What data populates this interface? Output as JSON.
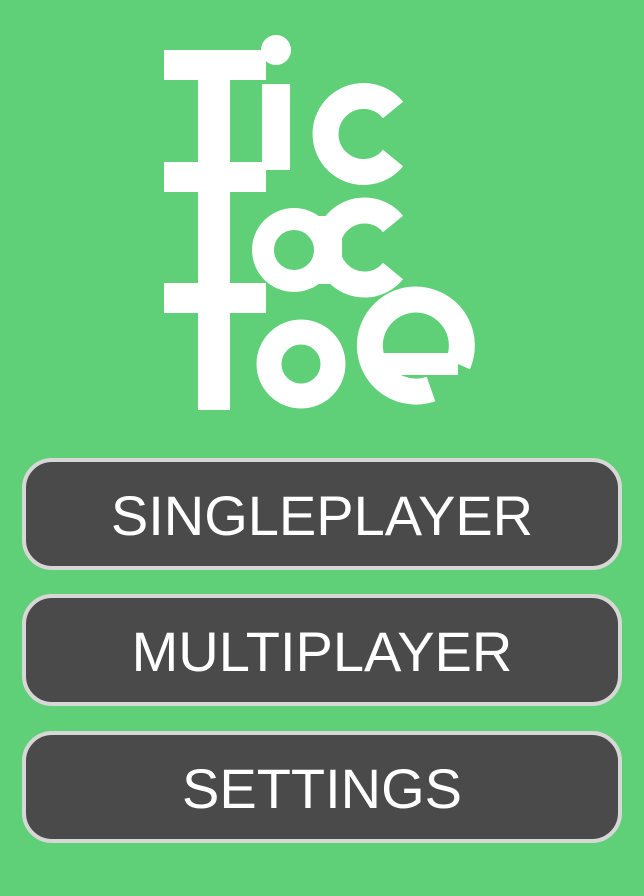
{
  "title": {
    "lines": [
      "Tic",
      "Tac",
      "Toe"
    ]
  },
  "menu": {
    "buttons": [
      {
        "label": "SINGLEPLAYER"
      },
      {
        "label": "MULTIPLAYER"
      },
      {
        "label": "SETTINGS"
      }
    ]
  },
  "colors": {
    "background": "#5fcf78",
    "button_fill": "#4a4a4a",
    "button_border": "#d7d7d7",
    "text": "#ffffff"
  }
}
